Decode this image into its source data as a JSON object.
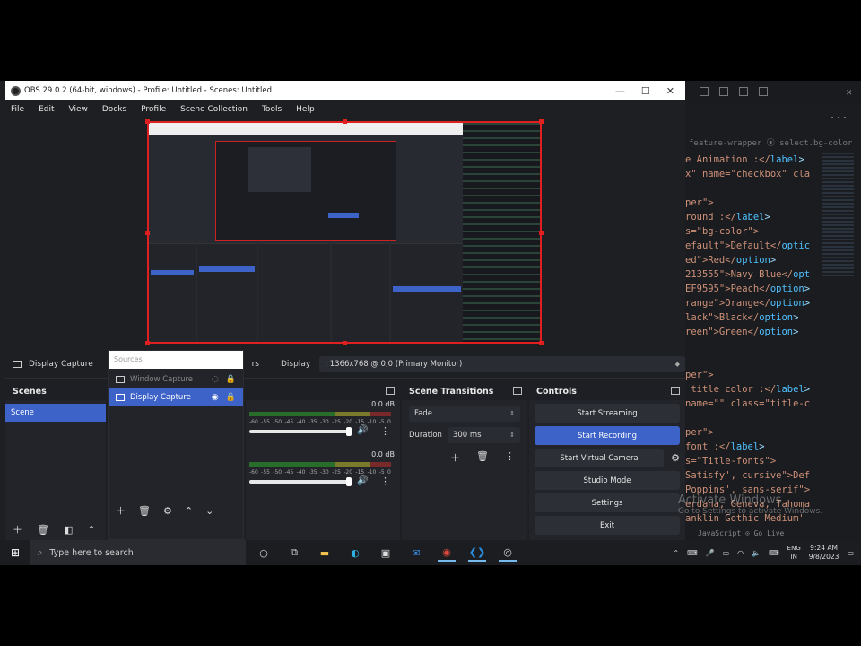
{
  "window": {
    "title": "OBS 29.0.2 (64-bit, windows) - Profile: Untitled - Scenes: Untitled",
    "controls": [
      "—",
      "☐",
      "✕"
    ]
  },
  "menu": [
    "File",
    "Edit",
    "View",
    "Docks",
    "Profile",
    "Scene Collection",
    "Tools",
    "Help"
  ],
  "toolbar": {
    "source_name": "Display Capture",
    "properties_label": "rs",
    "display_label": "Display",
    "display_value": ": 1366x768 @ 0,0 (Primary Monitor)"
  },
  "scenes": {
    "title": "Scenes",
    "items": [
      "Scene"
    ]
  },
  "sources": {
    "search_placeholder": "Sources",
    "items": [
      {
        "label": "Window Capture",
        "selected": false
      },
      {
        "label": "Display Capture",
        "selected": true
      }
    ]
  },
  "mixer": {
    "channels": [
      {
        "db": "0.0 dB"
      },
      {
        "db": "0.0 dB"
      }
    ],
    "ticks": [
      "-60",
      "-55",
      "-50",
      "-45",
      "-40",
      "-35",
      "-30",
      "-25",
      "-20",
      "-15",
      "-10",
      "-5",
      "0"
    ]
  },
  "transitions": {
    "title": "Scene Transitions",
    "type": "Fade",
    "duration_label": "Duration",
    "duration_value": "300 ms"
  },
  "controls": {
    "title": "Controls",
    "buttons": [
      "Start Streaming",
      "Start Recording",
      "Start Virtual Camera",
      "Studio Mode",
      "Settings",
      "Exit"
    ]
  },
  "editor": {
    "breadcrumb": "feature-wrapper  ⦿ select.bg-color",
    "lines": [
      {
        "a": "e Animation :</",
        "b": "label",
        "c": ">"
      },
      {
        "a": "x\" name=\"checkbox\" cla",
        "b": "",
        "c": ""
      },
      {
        "a": "",
        "b": "",
        "c": ""
      },
      {
        "a": "per\">",
        "b": "",
        "c": ""
      },
      {
        "a": "round :</",
        "b": "label",
        "c": ">"
      },
      {
        "a": "s=\"bg-color\">",
        "b": "",
        "c": ""
      },
      {
        "a": "efault\">Default</",
        "b": "optic",
        "c": ""
      },
      {
        "a": "ed\">Red</",
        "b": "option",
        "c": ">"
      },
      {
        "a": "213555\">Navy Blue</",
        "b": "opt",
        "c": ""
      },
      {
        "a": "EF9595\">Peach</",
        "b": "option",
        "c": ">"
      },
      {
        "a": "range\">Orange</",
        "b": "option",
        "c": ">"
      },
      {
        "a": "lack\">Black</",
        "b": "option",
        "c": ">"
      },
      {
        "a": "reen\">Green</",
        "b": "option",
        "c": ">"
      },
      {
        "a": "",
        "b": "",
        "c": ""
      },
      {
        "a": "",
        "b": "",
        "c": ""
      },
      {
        "a": "per\">",
        "b": "",
        "c": ""
      },
      {
        "a": " title color :</",
        "b": "label",
        "c": ">"
      },
      {
        "a": "name=\"\" class=\"title-c",
        "b": "",
        "c": ""
      },
      {
        "a": "",
        "b": "",
        "c": ""
      },
      {
        "a": "per\">",
        "b": "",
        "c": ""
      },
      {
        "a": "font :</",
        "b": "label",
        "c": ">"
      },
      {
        "a": "s=\"Title-fonts\">",
        "b": "",
        "c": ""
      },
      {
        "a": "Satisfy', cursive\">Def",
        "b": "",
        "c": ""
      },
      {
        "a": "Poppins', sans-serif\">",
        "b": "",
        "c": ""
      },
      {
        "a": "erdana, Geneva, Tahoma",
        "b": "",
        "c": ""
      },
      {
        "a": "anklin Gothic Medium'",
        "b": "",
        "c": ""
      }
    ],
    "status": "JavaScript  ⊙ Go Live"
  },
  "activation": {
    "line1": "Activate Windows",
    "line2": "Go to Settings to activate Windows."
  },
  "taskbar": {
    "search_placeholder": "Type here to search",
    "lang_top": "ENG",
    "lang_bottom": "IN",
    "time": "9:24 AM",
    "date": "9/8/2023"
  },
  "colors": {
    "accent": "#3d62c8",
    "preview_border": "#e02020"
  }
}
